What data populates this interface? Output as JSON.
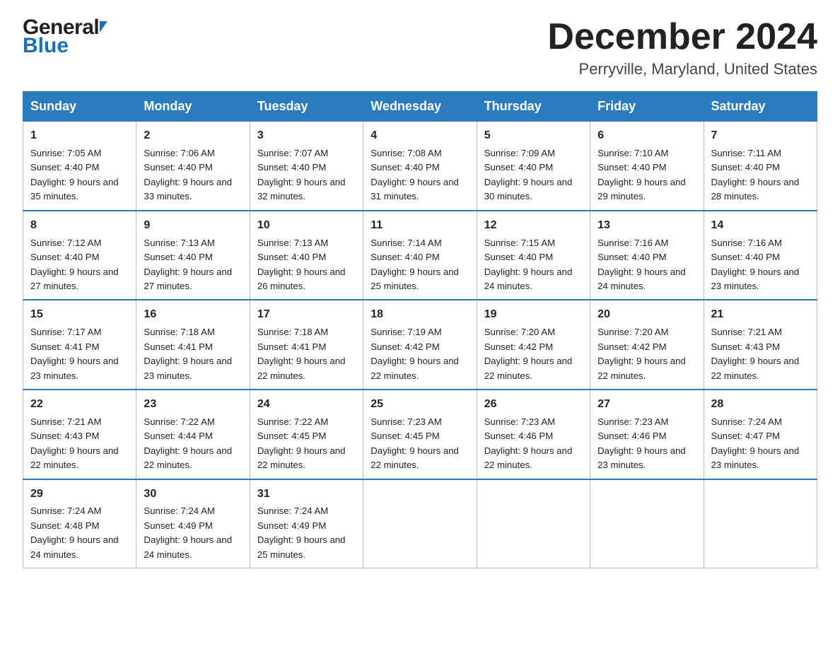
{
  "header": {
    "logo_line1": "General",
    "logo_line2": "Blue",
    "month_title": "December 2024",
    "location": "Perryville, Maryland, United States"
  },
  "weekdays": [
    "Sunday",
    "Monday",
    "Tuesday",
    "Wednesday",
    "Thursday",
    "Friday",
    "Saturday"
  ],
  "weeks": [
    [
      {
        "day": "1",
        "sunrise": "7:05 AM",
        "sunset": "4:40 PM",
        "daylight": "9 hours and 35 minutes."
      },
      {
        "day": "2",
        "sunrise": "7:06 AM",
        "sunset": "4:40 PM",
        "daylight": "9 hours and 33 minutes."
      },
      {
        "day": "3",
        "sunrise": "7:07 AM",
        "sunset": "4:40 PM",
        "daylight": "9 hours and 32 minutes."
      },
      {
        "day": "4",
        "sunrise": "7:08 AM",
        "sunset": "4:40 PM",
        "daylight": "9 hours and 31 minutes."
      },
      {
        "day": "5",
        "sunrise": "7:09 AM",
        "sunset": "4:40 PM",
        "daylight": "9 hours and 30 minutes."
      },
      {
        "day": "6",
        "sunrise": "7:10 AM",
        "sunset": "4:40 PM",
        "daylight": "9 hours and 29 minutes."
      },
      {
        "day": "7",
        "sunrise": "7:11 AM",
        "sunset": "4:40 PM",
        "daylight": "9 hours and 28 minutes."
      }
    ],
    [
      {
        "day": "8",
        "sunrise": "7:12 AM",
        "sunset": "4:40 PM",
        "daylight": "9 hours and 27 minutes."
      },
      {
        "day": "9",
        "sunrise": "7:13 AM",
        "sunset": "4:40 PM",
        "daylight": "9 hours and 27 minutes."
      },
      {
        "day": "10",
        "sunrise": "7:13 AM",
        "sunset": "4:40 PM",
        "daylight": "9 hours and 26 minutes."
      },
      {
        "day": "11",
        "sunrise": "7:14 AM",
        "sunset": "4:40 PM",
        "daylight": "9 hours and 25 minutes."
      },
      {
        "day": "12",
        "sunrise": "7:15 AM",
        "sunset": "4:40 PM",
        "daylight": "9 hours and 24 minutes."
      },
      {
        "day": "13",
        "sunrise": "7:16 AM",
        "sunset": "4:40 PM",
        "daylight": "9 hours and 24 minutes."
      },
      {
        "day": "14",
        "sunrise": "7:16 AM",
        "sunset": "4:40 PM",
        "daylight": "9 hours and 23 minutes."
      }
    ],
    [
      {
        "day": "15",
        "sunrise": "7:17 AM",
        "sunset": "4:41 PM",
        "daylight": "9 hours and 23 minutes."
      },
      {
        "day": "16",
        "sunrise": "7:18 AM",
        "sunset": "4:41 PM",
        "daylight": "9 hours and 23 minutes."
      },
      {
        "day": "17",
        "sunrise": "7:18 AM",
        "sunset": "4:41 PM",
        "daylight": "9 hours and 22 minutes."
      },
      {
        "day": "18",
        "sunrise": "7:19 AM",
        "sunset": "4:42 PM",
        "daylight": "9 hours and 22 minutes."
      },
      {
        "day": "19",
        "sunrise": "7:20 AM",
        "sunset": "4:42 PM",
        "daylight": "9 hours and 22 minutes."
      },
      {
        "day": "20",
        "sunrise": "7:20 AM",
        "sunset": "4:42 PM",
        "daylight": "9 hours and 22 minutes."
      },
      {
        "day": "21",
        "sunrise": "7:21 AM",
        "sunset": "4:43 PM",
        "daylight": "9 hours and 22 minutes."
      }
    ],
    [
      {
        "day": "22",
        "sunrise": "7:21 AM",
        "sunset": "4:43 PM",
        "daylight": "9 hours and 22 minutes."
      },
      {
        "day": "23",
        "sunrise": "7:22 AM",
        "sunset": "4:44 PM",
        "daylight": "9 hours and 22 minutes."
      },
      {
        "day": "24",
        "sunrise": "7:22 AM",
        "sunset": "4:45 PM",
        "daylight": "9 hours and 22 minutes."
      },
      {
        "day": "25",
        "sunrise": "7:23 AM",
        "sunset": "4:45 PM",
        "daylight": "9 hours and 22 minutes."
      },
      {
        "day": "26",
        "sunrise": "7:23 AM",
        "sunset": "4:46 PM",
        "daylight": "9 hours and 22 minutes."
      },
      {
        "day": "27",
        "sunrise": "7:23 AM",
        "sunset": "4:46 PM",
        "daylight": "9 hours and 23 minutes."
      },
      {
        "day": "28",
        "sunrise": "7:24 AM",
        "sunset": "4:47 PM",
        "daylight": "9 hours and 23 minutes."
      }
    ],
    [
      {
        "day": "29",
        "sunrise": "7:24 AM",
        "sunset": "4:48 PM",
        "daylight": "9 hours and 24 minutes."
      },
      {
        "day": "30",
        "sunrise": "7:24 AM",
        "sunset": "4:49 PM",
        "daylight": "9 hours and 24 minutes."
      },
      {
        "day": "31",
        "sunrise": "7:24 AM",
        "sunset": "4:49 PM",
        "daylight": "9 hours and 25 minutes."
      },
      null,
      null,
      null,
      null
    ]
  ],
  "labels": {
    "sunrise": "Sunrise: ",
    "sunset": "Sunset: ",
    "daylight": "Daylight: "
  }
}
